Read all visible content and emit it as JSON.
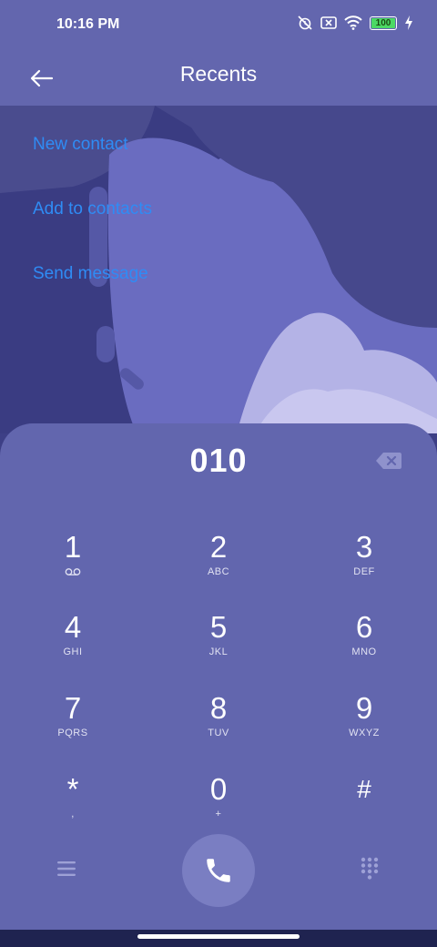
{
  "status_bar": {
    "time": "10:16 PM",
    "battery_level": "100",
    "icons": [
      "alarm-off-icon",
      "sim-off-icon",
      "wifi-icon",
      "battery-icon",
      "charging-icon"
    ]
  },
  "toolbar": {
    "back_icon": "back-arrow-icon",
    "title": "Recents"
  },
  "menu": {
    "items": [
      {
        "label": "New contact"
      },
      {
        "label": "Add to contacts"
      },
      {
        "label": "Send message"
      }
    ]
  },
  "dialer": {
    "number": "010",
    "backspace_icon": "backspace-icon",
    "keys": [
      {
        "digit": "1",
        "letters": "",
        "sub_icon": "voicemail-icon"
      },
      {
        "digit": "2",
        "letters": "ABC"
      },
      {
        "digit": "3",
        "letters": "DEF"
      },
      {
        "digit": "4",
        "letters": "GHI"
      },
      {
        "digit": "5",
        "letters": "JKL"
      },
      {
        "digit": "6",
        "letters": "MNO"
      },
      {
        "digit": "7",
        "letters": "PQRS"
      },
      {
        "digit": "8",
        "letters": "TUV"
      },
      {
        "digit": "9",
        "letters": "WXYZ"
      },
      {
        "digit": "*",
        "letters": ","
      },
      {
        "digit": "0",
        "letters": "+"
      },
      {
        "digit": "#",
        "letters": ""
      }
    ],
    "bottom": {
      "menu_icon": "hamburger-menu-icon",
      "call_icon": "phone-icon",
      "keypad_icon": "keypad-grid-icon"
    }
  },
  "colors": {
    "panel": "#6266ae",
    "link": "#2f8cf5",
    "call_button": "#7a7ec2"
  }
}
